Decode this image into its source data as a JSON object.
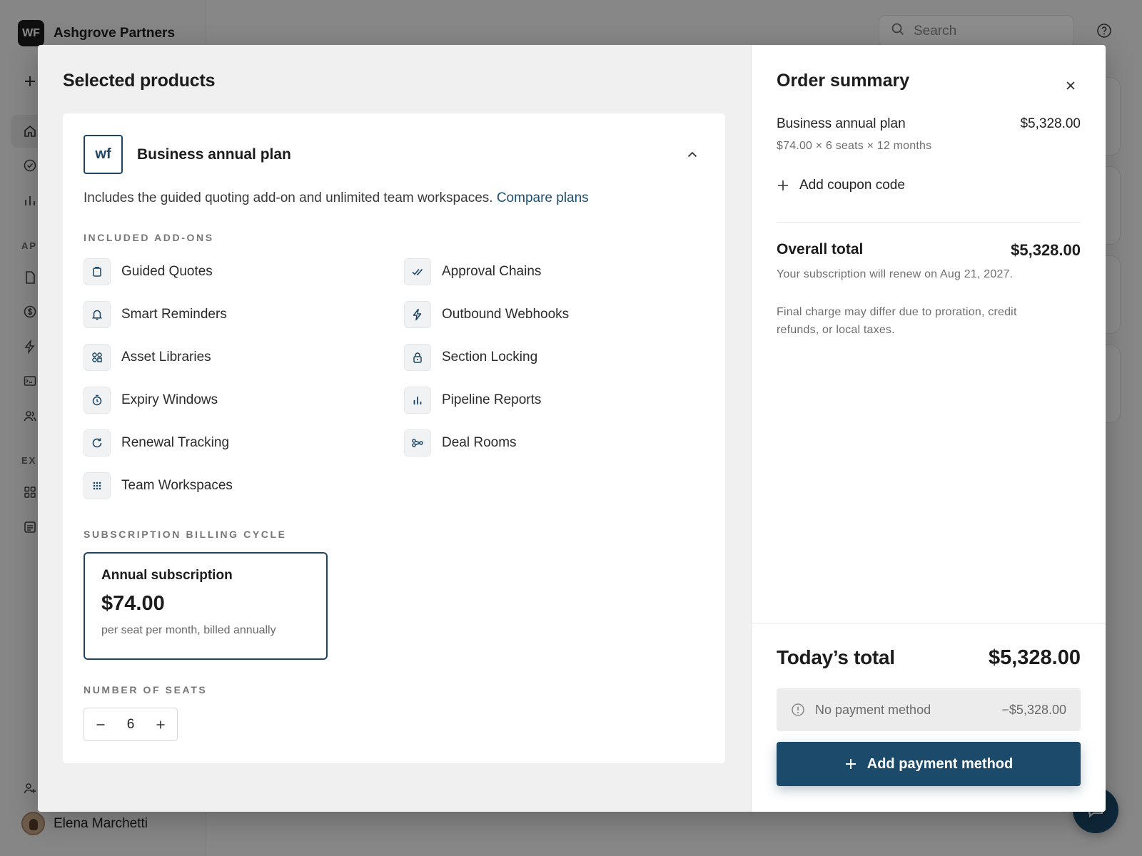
{
  "app": {
    "brand_initials": "WF",
    "brand_name": "Ashgrove Partners",
    "search_placeholder": "Search",
    "sidebar_sections": [
      "AP",
      "EX"
    ],
    "user_name": "Elena Marchetti"
  },
  "modal": {
    "left_title": "Selected products",
    "product": {
      "logo_text": "wf",
      "name": "Business annual plan",
      "description": "Includes the guided quoting add-on and unlimited team workspaces.",
      "compare_link": "Compare plans",
      "addons_label": "INCLUDED ADD-ONS",
      "addons": [
        {
          "label": "Guided Quotes",
          "icon": "clipboard-icon"
        },
        {
          "label": "Approval Chains",
          "icon": "double-check-icon"
        },
        {
          "label": "Smart Reminders",
          "icon": "bell-icon"
        },
        {
          "label": "Outbound Webhooks",
          "icon": "lightning-icon"
        },
        {
          "label": "Asset Libraries",
          "icon": "shapes-icon"
        },
        {
          "label": "Section Locking",
          "icon": "lock-icon"
        },
        {
          "label": "Expiry Windows",
          "icon": "timer-icon"
        },
        {
          "label": "Pipeline Reports",
          "icon": "bar-chart-icon"
        },
        {
          "label": "Renewal Tracking",
          "icon": "refresh-icon"
        },
        {
          "label": "Deal Rooms",
          "icon": "share-nodes-icon"
        },
        {
          "label": "Team Workspaces",
          "icon": "grid-dots-icon"
        }
      ],
      "billing_label": "SUBSCRIPTION BILLING CYCLE",
      "billing": {
        "title": "Annual subscription",
        "price": "$74.00",
        "note": "per seat per month, billed annually"
      },
      "seats_label": "NUMBER OF SEATS",
      "seats": "6"
    },
    "summary": {
      "title": "Order summary",
      "line_name": "Business annual plan",
      "line_amount": "$5,328.00",
      "line_detail": "$74.00 × 6 seats × 12 months",
      "coupon_label": "Add coupon code",
      "overall_label": "Overall total",
      "overall_amount": "$5,328.00",
      "renew_note": "Your subscription will renew on Aug 21, 2027.",
      "fine_note": "Final charge may differ due to proration, credit refunds, or local taxes.",
      "today_label": "Today’s total",
      "today_amount": "$5,328.00",
      "no_payment_label": "No payment method",
      "no_payment_amount": "−$5,328.00",
      "add_payment_label": "Add payment method"
    }
  },
  "colors": {
    "accent": "#1b4a6b",
    "link": "#1b4f72"
  }
}
